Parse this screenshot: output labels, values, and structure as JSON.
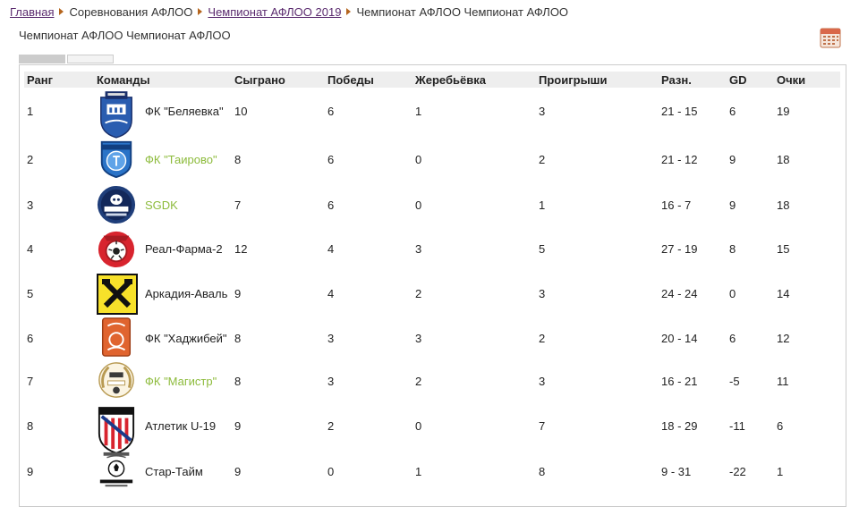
{
  "breadcrumb": {
    "home": "Главная",
    "competitions": "Соревнования АФЛОО",
    "championship_year": "Чемпионат АФЛОО 2019",
    "current": "Чемпионат АФЛОО Чемпионат АФЛОО"
  },
  "page_title": "Чемпионат АФЛОО Чемпионат АФЛОО",
  "table": {
    "headers": {
      "rank": "Ранг",
      "team": "Команды",
      "played": "Сыграно",
      "wins": "Победы",
      "draws": "Жеребьёвка",
      "losses": "Проигрыши",
      "diff": "Разн.",
      "gd": "GD",
      "points": "Очки"
    },
    "rows": [
      {
        "rank": "1",
        "team": "ФК \"Беляевка\"",
        "played": "10",
        "wins": "6",
        "draws": "1",
        "losses": "3",
        "diff": "21 - 15",
        "gd": "6",
        "points": "19",
        "logo": "belyaevka-crest-icon",
        "link": false
      },
      {
        "rank": "2",
        "team": "ФК \"Таирово\"",
        "played": "8",
        "wins": "6",
        "draws": "0",
        "losses": "2",
        "diff": "21 - 12",
        "gd": "9",
        "points": "18",
        "logo": "tairovo-crest-icon",
        "link": true
      },
      {
        "rank": "3",
        "team": "SGDK",
        "played": "7",
        "wins": "6",
        "draws": "0",
        "losses": "1",
        "diff": "16 - 7",
        "gd": "9",
        "points": "18",
        "logo": "sgdk-skull-crest-icon",
        "link": true
      },
      {
        "rank": "4",
        "team": "Реал-Фарма-2",
        "played": "12",
        "wins": "4",
        "draws": "3",
        "losses": "5",
        "diff": "27 - 19",
        "gd": "8",
        "points": "15",
        "logo": "real-pharma-crest-icon",
        "link": false
      },
      {
        "rank": "5",
        "team": "Аркадия-Аваль",
        "played": "9",
        "wins": "4",
        "draws": "2",
        "losses": "3",
        "diff": "24 - 24",
        "gd": "0",
        "points": "14",
        "logo": "arkadia-aval-crest-icon",
        "link": false
      },
      {
        "rank": "6",
        "team": "ФК \"Хаджибей\"",
        "played": "8",
        "wins": "3",
        "draws": "3",
        "losses": "2",
        "diff": "20 - 14",
        "gd": "6",
        "points": "12",
        "logo": "khadzhibey-crest-icon",
        "link": false
      },
      {
        "rank": "7",
        "team": "ФК \"Магистр\"",
        "played": "8",
        "wins": "3",
        "draws": "2",
        "losses": "3",
        "diff": "16 - 21",
        "gd": "-5",
        "points": "11",
        "logo": "magistr-crest-icon",
        "link": true
      },
      {
        "rank": "8",
        "team": "Атлетик U-19",
        "played": "9",
        "wins": "2",
        "draws": "0",
        "losses": "7",
        "diff": "18 - 29",
        "gd": "-11",
        "points": "6",
        "logo": "atletik-crest-icon",
        "link": false
      },
      {
        "rank": "9",
        "team": "Стар-Тайм",
        "played": "9",
        "wins": "0",
        "draws": "1",
        "losses": "8",
        "diff": "9 - 31",
        "gd": "-22",
        "points": "1",
        "logo": "star-time-crest-icon",
        "link": false
      }
    ]
  },
  "colors": {
    "link_green": "#8dbb3c",
    "breadcrumb_link": "#5a2a6e",
    "separator": "#b5651d"
  }
}
